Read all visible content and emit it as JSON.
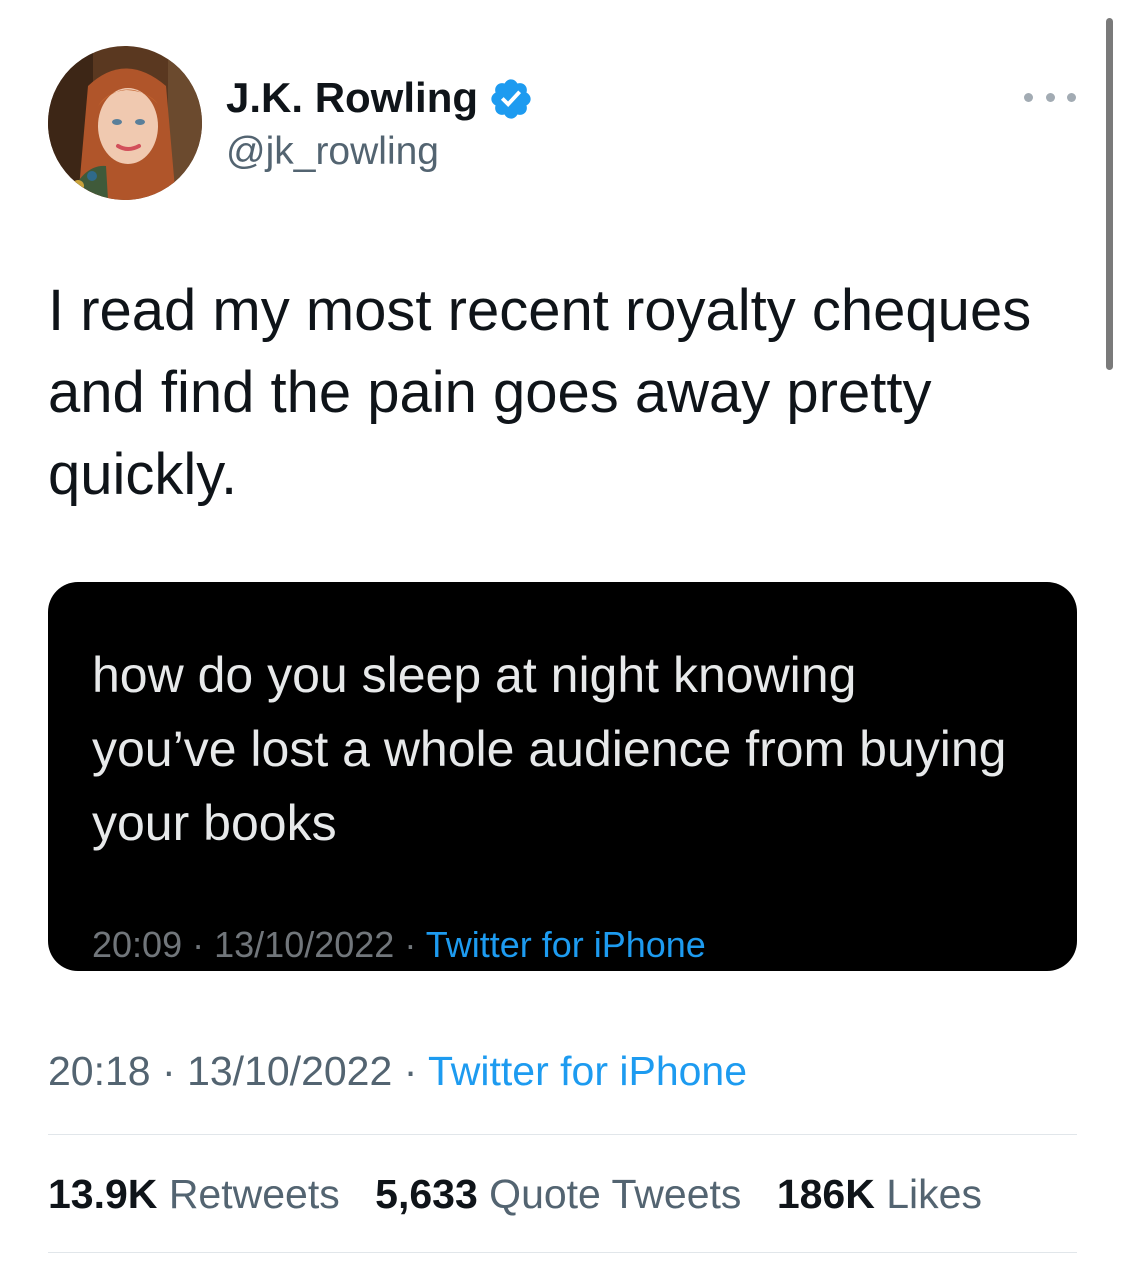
{
  "author": {
    "display_name": "J.K. Rowling",
    "handle": "@jk_rowling",
    "verified": true
  },
  "tweet": {
    "text": "I read my most recent royalty cheques and find the pain goes away pretty quickly.",
    "time": "20:18",
    "date": "13/10/2022",
    "separator": "·",
    "source": "Twitter for iPhone"
  },
  "embedded_tweet": {
    "text": "how do you sleep at night knowing you’ve lost a whole audience from buying your books",
    "time": "20:09",
    "date": "13/10/2022",
    "separator": "·",
    "source": "Twitter for iPhone"
  },
  "stats": {
    "retweets_count": "13.9K",
    "retweets_label": "Retweets",
    "quote_tweets_count": "5,633",
    "quote_tweets_label": "Quote Tweets",
    "likes_count": "186K",
    "likes_label": "Likes"
  },
  "icons": {
    "verified": "verified-badge-icon",
    "more": "more-options-icon"
  },
  "colors": {
    "link": "#1d9bf0",
    "verified": "#1d9bf0",
    "secondary_text": "#536471",
    "embed_background": "#000000"
  }
}
